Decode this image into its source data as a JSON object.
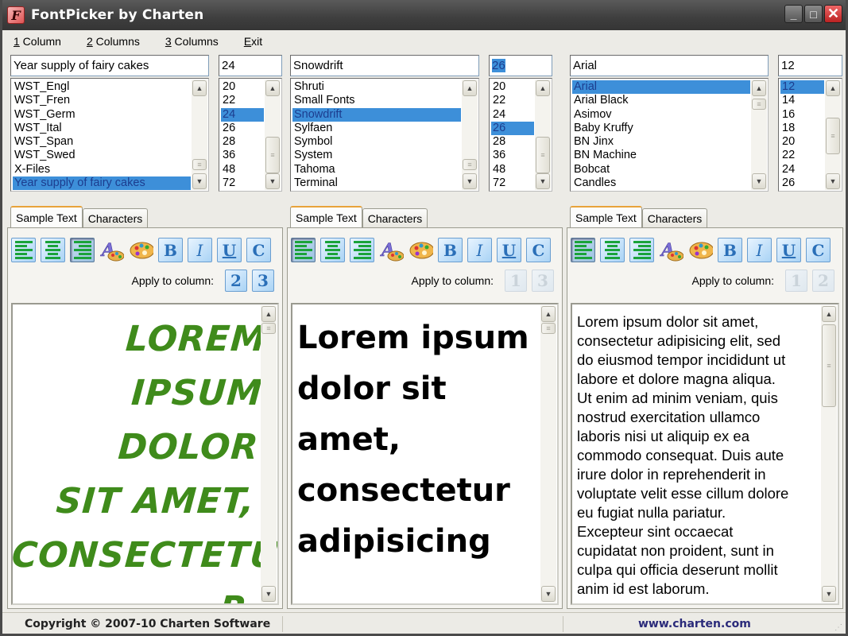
{
  "window": {
    "title": "FontPicker by Charten",
    "controls": {
      "minimize": "_",
      "maximize": "□",
      "close": "✕"
    }
  },
  "menu": [
    {
      "key": "1",
      "rest": " Column"
    },
    {
      "key": "2",
      "rest": " Columns"
    },
    {
      "key": "3",
      "rest": " Columns"
    },
    {
      "key": "E",
      "rest": "xit"
    }
  ],
  "columns": [
    {
      "font_input": "Year supply of fairy cakes",
      "size_input": "24",
      "size_input_selected": false,
      "fonts": [
        "WST_Engl",
        "WST_Fren",
        "WST_Germ",
        "WST_Ital",
        "WST_Span",
        "WST_Swed",
        "X-Files",
        "Year supply of fairy cakes"
      ],
      "selected_font": "Year supply of fairy cakes",
      "sizes": [
        "20",
        "22",
        "24",
        "26",
        "28",
        "36",
        "48",
        "72"
      ],
      "selected_size": "24",
      "tabs": [
        "Sample Text",
        "Characters"
      ],
      "active_tab": "Sample Text",
      "alignment": "right",
      "apply_label": "Apply to column:",
      "apply_targets": [
        {
          "label": "2",
          "enabled": true
        },
        {
          "label": "3",
          "enabled": true
        }
      ],
      "preview_lines": [
        "LOREM",
        "IPSUM DOLOR",
        "SIT AMET,",
        "CONSECTETU",
        "R"
      ]
    },
    {
      "font_input": "Snowdrift",
      "size_input": "26",
      "size_input_selected": true,
      "fonts": [
        "Shruti",
        "Small Fonts",
        "Snowdrift",
        "Sylfaen",
        "Symbol",
        "System",
        "Tahoma",
        "Terminal"
      ],
      "selected_font": "Snowdrift",
      "sizes": [
        "20",
        "22",
        "24",
        "26",
        "28",
        "36",
        "48",
        "72"
      ],
      "selected_size": "26",
      "tabs": [
        "Sample Text",
        "Characters"
      ],
      "active_tab": "Sample Text",
      "alignment": "left",
      "apply_label": "Apply to column:",
      "apply_targets": [
        {
          "label": "1",
          "enabled": false
        },
        {
          "label": "3",
          "enabled": false
        }
      ],
      "preview_lines": [
        "Lorem ipsum",
        "dolor sit",
        "amet,",
        "consectetur",
        "adipisicing"
      ]
    },
    {
      "font_input": "Arial",
      "size_input": "12",
      "size_input_selected": false,
      "fonts": [
        "Arial",
        "Arial Black",
        "Asimov",
        "Baby Kruffy",
        "BN Jinx",
        "BN Machine",
        "Bobcat",
        "Candles"
      ],
      "selected_font": "Arial",
      "sizes": [
        "12",
        "14",
        "16",
        "18",
        "20",
        "22",
        "24",
        "26"
      ],
      "selected_size": "12",
      "tabs": [
        "Sample Text",
        "Characters"
      ],
      "active_tab": "Sample Text",
      "alignment": "left",
      "apply_label": "Apply to column:",
      "apply_targets": [
        {
          "label": "1",
          "enabled": false
        },
        {
          "label": "2",
          "enabled": false
        }
      ],
      "preview_lines": [
        "Lorem ipsum dolor sit amet,",
        "consectetur adipisicing elit, sed",
        "do eiusmod tempor incididunt ut",
        "labore et dolore magna aliqua.",
        "Ut enim ad minim veniam, quis",
        "nostrud exercitation ullamco",
        "laboris nisi ut aliquip ex ea",
        "commodo consequat. Duis aute",
        "irure dolor in reprehenderit in",
        "voluptate velit esse cillum dolore",
        "eu fugiat nulla pariatur.",
        "Excepteur sint occaecat",
        "cupidatat non proident, sunt in",
        "culpa qui officia deserunt mollit",
        "anim id est laborum."
      ]
    }
  ],
  "toolbar_labels": {
    "bold": "B",
    "italic": "I",
    "underline": "U",
    "case": "C"
  },
  "status": {
    "copyright": "Copyright © 2007-10 Charten Software",
    "website": "www.charten.com"
  },
  "colors": {
    "selection": "#3d8fd9",
    "preview_col1": "#3f8b1b",
    "link": "#2a2a7a",
    "tab_accent": "#e8a33a"
  }
}
